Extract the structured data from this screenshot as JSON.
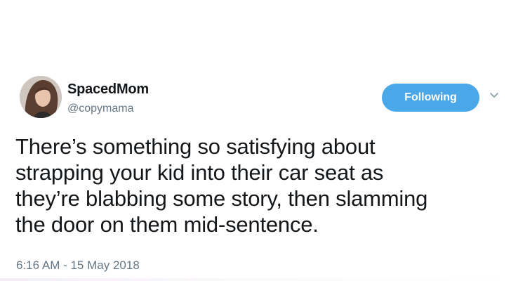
{
  "user": {
    "display_name": "SpacedMom",
    "handle": "@copymama"
  },
  "follow_button": {
    "label": "Following",
    "color": "#4aa8e8"
  },
  "menu": {
    "icon": "chevron-down-icon"
  },
  "tweet": {
    "lines": [
      "There’s something so satisfying about",
      "strapping your kid into their car seat as",
      "they’re blabbing some story, then slamming",
      "the door on them mid-sentence."
    ],
    "timestamp": "6:16 AM - 15 May 2018"
  },
  "colors": {
    "text": "#14171a",
    "secondary": "#657786"
  }
}
